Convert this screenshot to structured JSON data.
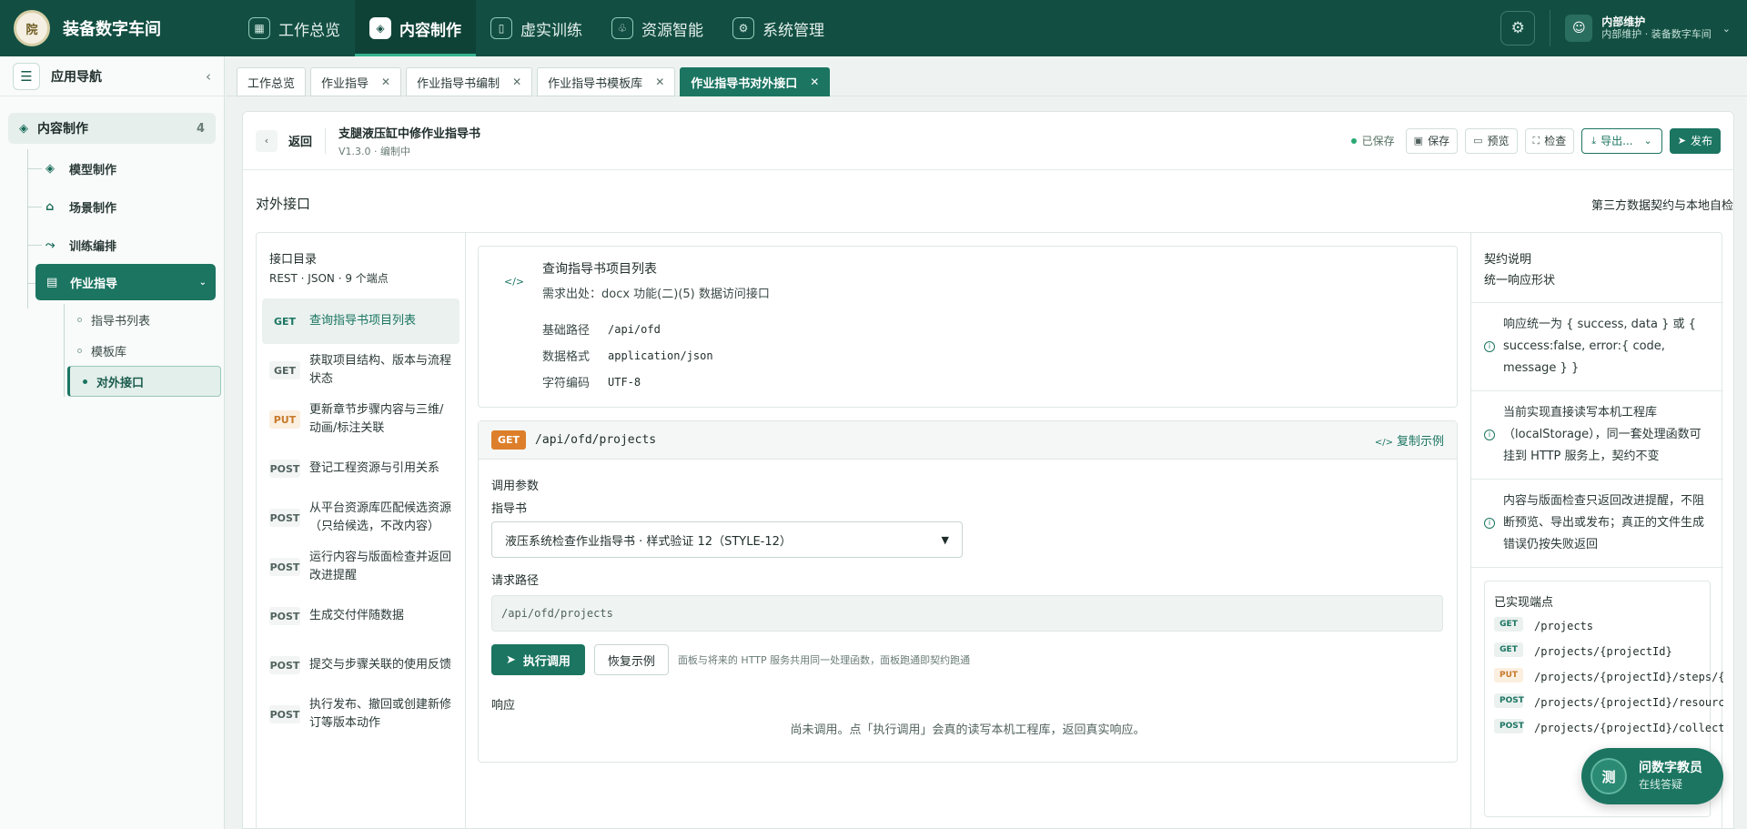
{
  "brand": {
    "name": "装备数字车间",
    "logo_text": "院"
  },
  "nav": {
    "items": [
      {
        "label": "工作总览",
        "icon": "grid-icon"
      },
      {
        "label": "内容制作",
        "icon": "cube-icon",
        "active": true
      },
      {
        "label": "虚实训练",
        "icon": "book-icon"
      },
      {
        "label": "资源智能",
        "icon": "sprout-icon"
      },
      {
        "label": "系统管理",
        "icon": "gear-icon"
      }
    ]
  },
  "user": {
    "name": "内部维护",
    "sub": "内部维护 · 装备数字车间"
  },
  "sidebar": {
    "title": "应用导航",
    "group": {
      "label": "内容制作",
      "count": "4"
    },
    "items": [
      {
        "label": "模型制作"
      },
      {
        "label": "场景制作"
      },
      {
        "label": "训练编排"
      },
      {
        "label": "作业指导",
        "active": true
      }
    ],
    "sub_items": [
      {
        "label": "指导书列表"
      },
      {
        "label": "模板库"
      },
      {
        "label": "对外接口",
        "active": true
      }
    ]
  },
  "tabs": [
    {
      "label": "工作总览"
    },
    {
      "label": "作业指导"
    },
    {
      "label": "作业指导书编制"
    },
    {
      "label": "作业指导书模板库"
    },
    {
      "label": "作业指导书对外接口",
      "active": true
    }
  ],
  "doc": {
    "back": "返回",
    "title": "支腿液压缸中修作业指导书",
    "version": "V1.3.0 · 编制中",
    "saved": "已保存",
    "save": "保存",
    "preview": "预览",
    "check": "检查",
    "export": "导出...",
    "publish": "发布"
  },
  "section": {
    "title": "对外接口",
    "subtitle": "第三方数据契约与本地自检"
  },
  "directory": {
    "title": "接口目录",
    "subtitle": "REST · JSON · 9 个端点",
    "endpoints": [
      {
        "method": "GET",
        "label": "查询指导书项目列表",
        "active": true
      },
      {
        "method": "GET",
        "label": "获取项目结构、版本与流程状态"
      },
      {
        "method": "PUT",
        "label": "更新章节步骤内容与三维/动画/标注关联"
      },
      {
        "method": "POST",
        "label": "登记工程资源与引用关系"
      },
      {
        "method": "POST",
        "label": "从平台资源库匹配候选资源（只给候选，不改内容）"
      },
      {
        "method": "POST",
        "label": "运行内容与版面检查并返回改进提醒"
      },
      {
        "method": "POST",
        "label": "生成交付伴随数据"
      },
      {
        "method": "POST",
        "label": "提交与步骤关联的使用反馈"
      },
      {
        "method": "POST",
        "label": "执行发布、撤回或创建新修订等版本动作"
      }
    ]
  },
  "endpoint_info": {
    "title": "查询指导书项目列表",
    "source": "需求出处：docx 功能(二)(5) 数据访问接口",
    "base_path_label": "基础路径",
    "base_path": "/api/ofd",
    "format_label": "数据格式",
    "format": "application/json",
    "encoding_label": "字符编码",
    "encoding": "UTF-8"
  },
  "request": {
    "method": "GET",
    "path": "/api/ofd/projects",
    "copy": "复制示例",
    "params_label": "调用参数",
    "guide_label": "指导书",
    "guide_value": "液压系统检查作业指导书 · 样式验证 12（STYLE-12）",
    "path_label": "请求路径",
    "path_value": "/api/ofd/projects",
    "run": "执行调用",
    "reset": "恢复示例",
    "hint": "面板与将来的 HTTP 服务共用同一处理函数，面板跑通即契约跑通",
    "response_label": "响应",
    "response_empty": "尚未调用。点「执行调用」会真的读写本机工程库，返回真实响应。"
  },
  "contract": {
    "title": "契约说明",
    "subtitle": "统一响应形状",
    "notes": [
      "响应统一为 { success, data } 或 { success:false, error:{ code, message } }",
      "当前实现直接读写本机工程库（localStorage），同一套处理函数可挂到 HTTP 服务上，契约不变",
      "内容与版面检查只返回改进提醒，不阻断预览、导出或发布；真正的文件生成错误仍按失败返回"
    ],
    "implemented_title": "已实现端点",
    "implemented": [
      {
        "method": "GET",
        "path": "/projects"
      },
      {
        "method": "GET",
        "path": "/projects/{projectId}"
      },
      {
        "method": "PUT",
        "path": "/projects/{projectId}/steps/{stepId}"
      },
      {
        "method": "POST",
        "path": "/projects/{projectId}/resources"
      },
      {
        "method": "POST",
        "path": "/projects/{projectId}/collect"
      }
    ]
  },
  "assistant": {
    "avatar": "测",
    "name": "问数字教员",
    "status": "在线答疑"
  },
  "colors": {
    "primary": "#1b7561",
    "topbar": "#124f42",
    "get": "#dd7f2a",
    "put": "#c77a2a"
  }
}
